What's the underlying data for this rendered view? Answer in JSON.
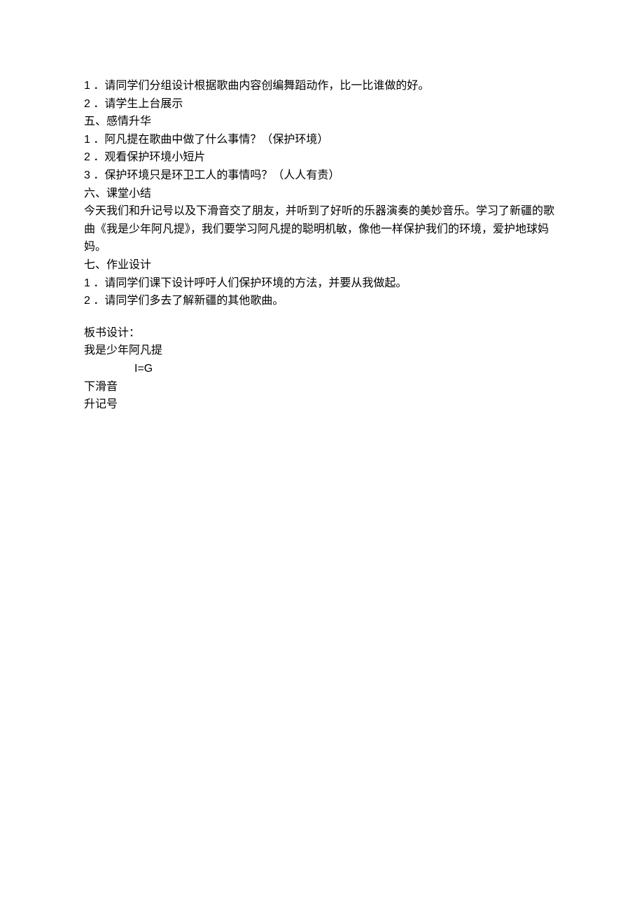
{
  "lines": {
    "l1_num": "1",
    "l1_text": " ．请同学们分组设计根据歌曲内容创编舞蹈动作，比一比谁做的好。",
    "l2_num": "2",
    "l2_text": " ．请学生上台展示",
    "l3": "五、感情升华",
    "l4_num": "1",
    "l4_text": " ．阿凡提在歌曲中做了什么事情？（保护环境）",
    "l5_num": "2",
    "l5_text": " ．观看保护环境小短片",
    "l6_num": "3",
    "l6_text": " ．保护环境只是环卫工人的事情吗？（人人有责）",
    "l7": "六、课堂小结",
    "l8": "今天我们和升记号以及下滑音交了朋友，并听到了好听的乐器演奏的美妙音乐。学习了新疆的歌曲《我是少年阿凡提》，我们要学习阿凡提的聪明机敏，像他一样保护我们的环境，爱护地球妈妈。",
    "l9": "七、作业设计",
    "l10_num": "1",
    "l10_text": " ．请同学们课下设计呼吁人们保护环境的方法，并要从我做起。",
    "l11_num": "2",
    "l11_text": " ．请同学们多去了解新疆的其他歌曲。",
    "l12": "板书设计：",
    "l13": "我是少年阿凡提",
    "l14": "I=G",
    "l15": "下滑音",
    "l16": "升记号"
  }
}
